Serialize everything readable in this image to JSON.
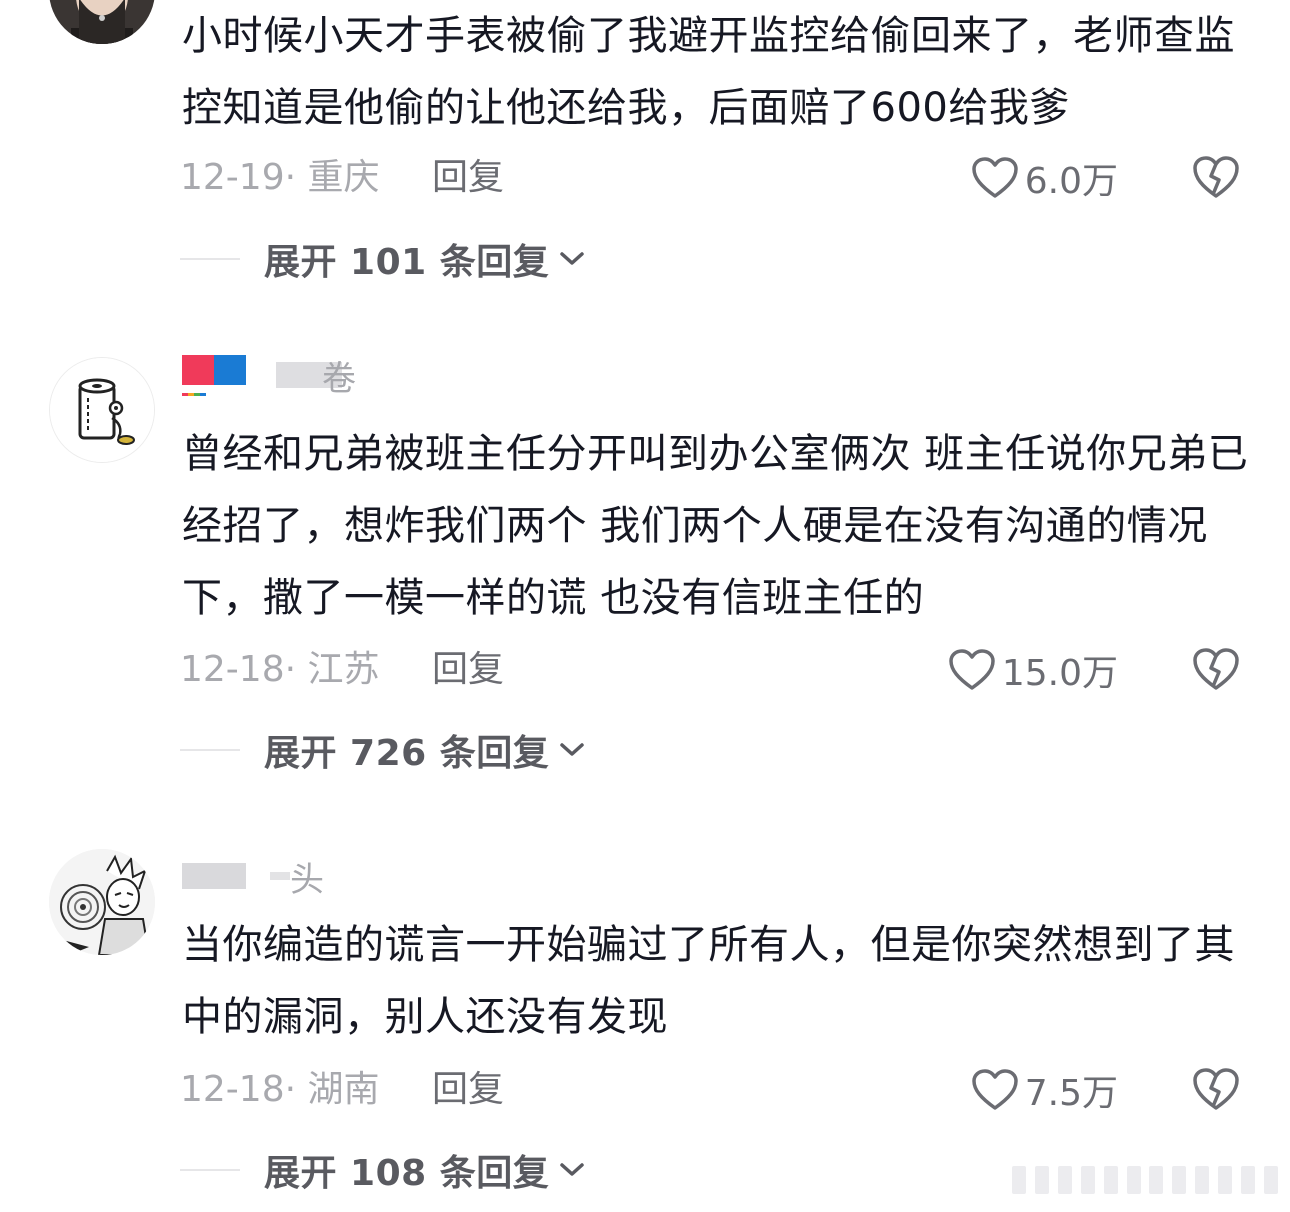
{
  "comments": [
    {
      "username": "",
      "text": "小时候小天才手表被偷了我避开监控给偷回来了，老师查监控知道是他偷的让他还给我，后面赔了600给我爹",
      "date": "12-19· 重庆",
      "reply_label": "回复",
      "likes": "6.0万",
      "expand_label": "展开 101 条回复",
      "avatar_icon": "profile-photo"
    },
    {
      "username": "卷",
      "text": "曾经和兄弟被班主任分开叫到办公室俩次 班主任说你兄弟已经招了，想炸我们两个 我们两个人硬是在没有沟通的情况下，撒了一模一样的谎 也没有信班主任的",
      "date": "12-18· 江苏",
      "reply_label": "回复",
      "likes": "15.0万",
      "expand_label": "展开 726 条回复",
      "avatar_icon": "toilet-paper-cartoon"
    },
    {
      "username": "头",
      "text": "当你编造的谎言一开始骗过了所有人，但是你突然想到了其中的漏洞，别人还没有发现",
      "date": "12-18· 湖南",
      "reply_label": "回复",
      "likes": "7.5万",
      "expand_label": "展开 108 条回复",
      "avatar_icon": "manga-character"
    }
  ],
  "icons": {
    "like": "heart-icon",
    "dislike": "broken-heart-icon",
    "expand": "chevron-down-icon"
  },
  "colors": {
    "text_primary": "#161823",
    "text_meta": "#a8a9ae",
    "text_action": "#6b6c72",
    "badge_red": "#f03a5a",
    "badge_blue": "#1a7bd4"
  }
}
